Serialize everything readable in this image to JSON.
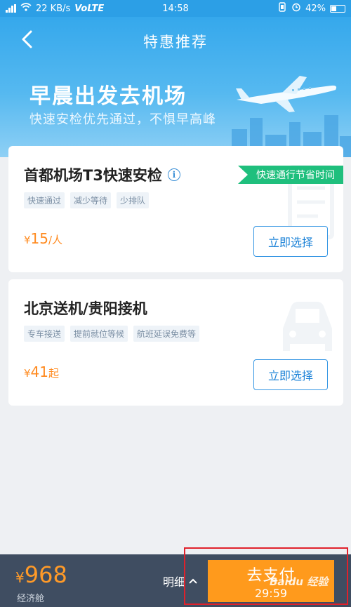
{
  "status_bar": {
    "network_speed": "22 KB/s",
    "carrier": "VoLTE",
    "time": "14:58",
    "battery": "42%"
  },
  "header": {
    "title": "特惠推荐",
    "back_icon": "chevron-left-icon"
  },
  "hero": {
    "title": "早晨出发去机场",
    "subtitle": "快速安检优先通过，不惧早高峰"
  },
  "cards": [
    {
      "title": "首都机场T3快速安检",
      "ribbon": "快速通行节省时间",
      "tags": [
        "快速通过",
        "减少等待",
        "少排队"
      ],
      "price_currency": "¥",
      "price_value": "15",
      "price_unit": "/人",
      "button": "立即选择",
      "bg_icon": "ticket-icon"
    },
    {
      "title": "北京送机/贵阳接机",
      "tags": [
        "专车接送",
        "提前就位等候",
        "航班延误免费等"
      ],
      "price_currency": "¥",
      "price_value": "41",
      "price_unit": "起",
      "button": "立即选择",
      "bg_icon": "car-icon"
    }
  ],
  "bottom_bar": {
    "total_currency": "¥",
    "total_value": "968",
    "cabin": "经济舱",
    "detail_label": "明细",
    "pay_label": "去支付",
    "timer": "29:59",
    "watermark": "Baidu 经验"
  },
  "colors": {
    "primary": "#2c9fe6",
    "accent_orange": "#ff9a1c",
    "ribbon_green": "#1fbf7d",
    "bottom_bar": "#3f4d61",
    "highlight_red": "#e0212b"
  }
}
